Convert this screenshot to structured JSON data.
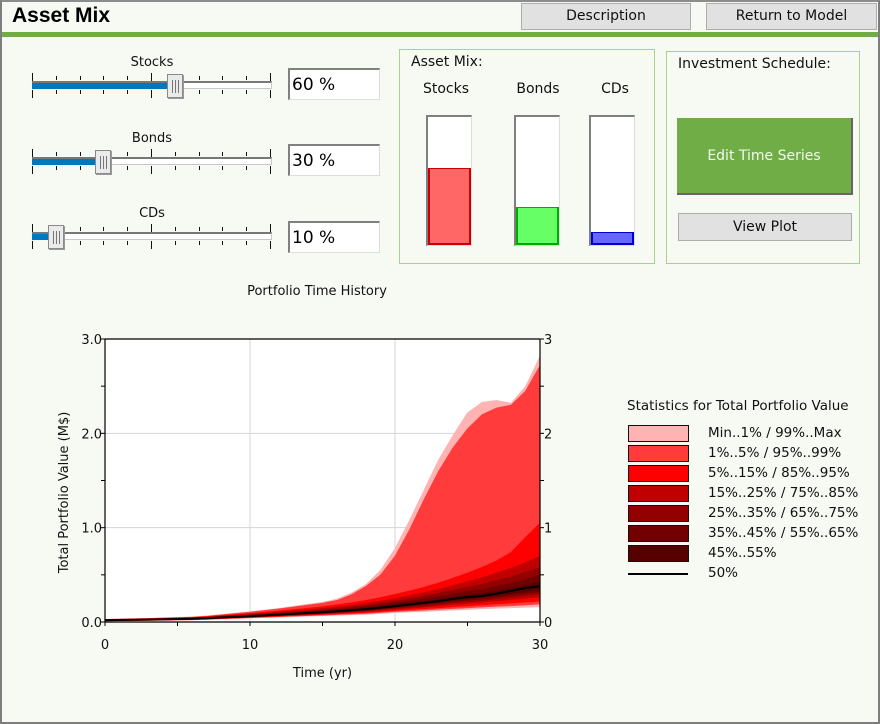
{
  "header": {
    "title": "Asset Mix",
    "buttons": {
      "description": "Description",
      "return_to_model": "Return to Model"
    }
  },
  "sliders": [
    {
      "label": "Stocks",
      "value_percent": 60,
      "display": "60 %"
    },
    {
      "label": "Bonds",
      "value_percent": 30,
      "display": "30 %"
    },
    {
      "label": "CDs",
      "value_percent": 10,
      "display": "10 %"
    }
  ],
  "asset_mix_panel": {
    "title": "Asset Mix:",
    "bars": [
      {
        "label": "Stocks",
        "value_percent": 60,
        "color": "#ff6666",
        "edge": "#cc0000"
      },
      {
        "label": "Bonds",
        "value_percent": 30,
        "color": "#66ff66",
        "edge": "#00aa00"
      },
      {
        "label": "CDs",
        "value_percent": 10,
        "color": "#6666ff",
        "edge": "#0000cc"
      }
    ]
  },
  "investment_panel": {
    "title": "Investment Schedule:",
    "edit_button": "Edit Time Series",
    "view_button": "View Plot"
  },
  "colors": {
    "accent_green": "#70ad47",
    "slider_fill": "#0078be"
  },
  "chart_data": {
    "type": "area",
    "title": "Portfolio Time History",
    "xlabel": "Time (yr)",
    "ylabel": "Total Portfolio Value (M$)",
    "xlim": [
      0,
      30
    ],
    "ylim": [
      0,
      3
    ],
    "x_ticks": [
      "0",
      "10",
      "20",
      "30"
    ],
    "y_ticks_left": [
      "0.0",
      "1.0",
      "2.0",
      "3.0"
    ],
    "y_ticks_right": [
      "0",
      "1",
      "2",
      "3"
    ],
    "grid": true,
    "legend_title": "Statistics for Total Portfolio Value",
    "legend_position": "right",
    "x": [
      0,
      3,
      6,
      7,
      8,
      10,
      12,
      14,
      15,
      16,
      17,
      18,
      19,
      20,
      21,
      22,
      23,
      24,
      25,
      26,
      27,
      28,
      29,
      30
    ],
    "percentiles": {
      "min": [
        0.01,
        0.015,
        0.02,
        0.025,
        0.03,
        0.04,
        0.05,
        0.06,
        0.065,
        0.07,
        0.075,
        0.08,
        0.09,
        0.1,
        0.105,
        0.11,
        0.12,
        0.125,
        0.13,
        0.14,
        0.145,
        0.15,
        0.155,
        0.16
      ],
      "p1": [
        0.012,
        0.017,
        0.023,
        0.028,
        0.034,
        0.045,
        0.056,
        0.067,
        0.072,
        0.078,
        0.084,
        0.09,
        0.1,
        0.11,
        0.118,
        0.125,
        0.135,
        0.142,
        0.15,
        0.158,
        0.165,
        0.172,
        0.18,
        0.19
      ],
      "p5": [
        0.013,
        0.019,
        0.026,
        0.031,
        0.037,
        0.05,
        0.061,
        0.073,
        0.079,
        0.086,
        0.093,
        0.1,
        0.11,
        0.12,
        0.13,
        0.14,
        0.15,
        0.16,
        0.17,
        0.18,
        0.19,
        0.2,
        0.21,
        0.22
      ],
      "p15": [
        0.015,
        0.021,
        0.029,
        0.034,
        0.041,
        0.053,
        0.066,
        0.079,
        0.086,
        0.094,
        0.102,
        0.11,
        0.121,
        0.133,
        0.145,
        0.157,
        0.17,
        0.183,
        0.195,
        0.208,
        0.222,
        0.236,
        0.25,
        0.265
      ],
      "p25": [
        0.016,
        0.022,
        0.031,
        0.036,
        0.043,
        0.056,
        0.07,
        0.084,
        0.092,
        0.1,
        0.109,
        0.118,
        0.13,
        0.143,
        0.157,
        0.17,
        0.185,
        0.2,
        0.214,
        0.228,
        0.245,
        0.262,
        0.28,
        0.3
      ],
      "p35": [
        0.017,
        0.023,
        0.032,
        0.038,
        0.045,
        0.058,
        0.073,
        0.088,
        0.096,
        0.105,
        0.115,
        0.125,
        0.138,
        0.152,
        0.167,
        0.182,
        0.198,
        0.214,
        0.23,
        0.246,
        0.264,
        0.283,
        0.303,
        0.325
      ],
      "p45": [
        0.018,
        0.024,
        0.033,
        0.039,
        0.047,
        0.06,
        0.076,
        0.092,
        0.1,
        0.11,
        0.12,
        0.131,
        0.145,
        0.16,
        0.176,
        0.192,
        0.209,
        0.226,
        0.243,
        0.26,
        0.279,
        0.3,
        0.322,
        0.345
      ],
      "p50": [
        0.02,
        0.025,
        0.034,
        0.04,
        0.048,
        0.062,
        0.078,
        0.095,
        0.104,
        0.114,
        0.125,
        0.137,
        0.152,
        0.168,
        0.185,
        0.203,
        0.222,
        0.245,
        0.265,
        0.275,
        0.3,
        0.33,
        0.36,
        0.38
      ],
      "p55": [
        0.021,
        0.026,
        0.035,
        0.042,
        0.05,
        0.065,
        0.082,
        0.1,
        0.11,
        0.121,
        0.133,
        0.146,
        0.162,
        0.18,
        0.199,
        0.219,
        0.24,
        0.265,
        0.288,
        0.3,
        0.328,
        0.36,
        0.395,
        0.42
      ],
      "p65": [
        0.022,
        0.028,
        0.038,
        0.045,
        0.054,
        0.07,
        0.089,
        0.109,
        0.12,
        0.132,
        0.146,
        0.161,
        0.18,
        0.2,
        0.222,
        0.245,
        0.27,
        0.298,
        0.325,
        0.345,
        0.38,
        0.415,
        0.455,
        0.5
      ],
      "p75": [
        0.023,
        0.03,
        0.041,
        0.048,
        0.058,
        0.075,
        0.096,
        0.118,
        0.13,
        0.144,
        0.16,
        0.177,
        0.198,
        0.222,
        0.248,
        0.275,
        0.305,
        0.338,
        0.37,
        0.4,
        0.44,
        0.48,
        0.53,
        0.58
      ],
      "p85": [
        0.024,
        0.032,
        0.044,
        0.052,
        0.063,
        0.082,
        0.105,
        0.13,
        0.144,
        0.16,
        0.178,
        0.198,
        0.222,
        0.25,
        0.28,
        0.312,
        0.348,
        0.388,
        0.428,
        0.47,
        0.52,
        0.57,
        0.63,
        0.7
      ],
      "p95": [
        0.026,
        0.035,
        0.048,
        0.057,
        0.069,
        0.092,
        0.118,
        0.147,
        0.164,
        0.183,
        0.205,
        0.23,
        0.26,
        0.295,
        0.33,
        0.37,
        0.415,
        0.465,
        0.52,
        0.58,
        0.65,
        0.74,
        0.9,
        1.05
      ],
      "p99": [
        0.028,
        0.038,
        0.052,
        0.062,
        0.076,
        0.105,
        0.14,
        0.18,
        0.2,
        0.23,
        0.29,
        0.38,
        0.5,
        0.7,
        0.98,
        1.3,
        1.6,
        1.85,
        2.05,
        2.2,
        2.27,
        2.3,
        2.45,
        2.72
      ],
      "max": [
        0.03,
        0.04,
        0.055,
        0.066,
        0.08,
        0.11,
        0.145,
        0.19,
        0.21,
        0.245,
        0.31,
        0.4,
        0.55,
        0.78,
        1.08,
        1.4,
        1.72,
        1.98,
        2.22,
        2.33,
        2.35,
        2.32,
        2.5,
        2.82
      ]
    },
    "legend": [
      {
        "label": "Min..1% / 99%..Max",
        "color": "#ffb3b3"
      },
      {
        "label": "1%..5% / 95%..99%",
        "color": "#ff3b3b"
      },
      {
        "label": "5%..15% / 85%..95%",
        "color": "#ff0000"
      },
      {
        "label": "15%..25% / 75%..85%",
        "color": "#c00000"
      },
      {
        "label": "25%..35% / 65%..75%",
        "color": "#930000"
      },
      {
        "label": "35%..45% / 55%..65%",
        "color": "#730000"
      },
      {
        "label": "45%..55%",
        "color": "#560000"
      },
      {
        "label": "50%",
        "color": "#000000",
        "line": true
      }
    ]
  }
}
